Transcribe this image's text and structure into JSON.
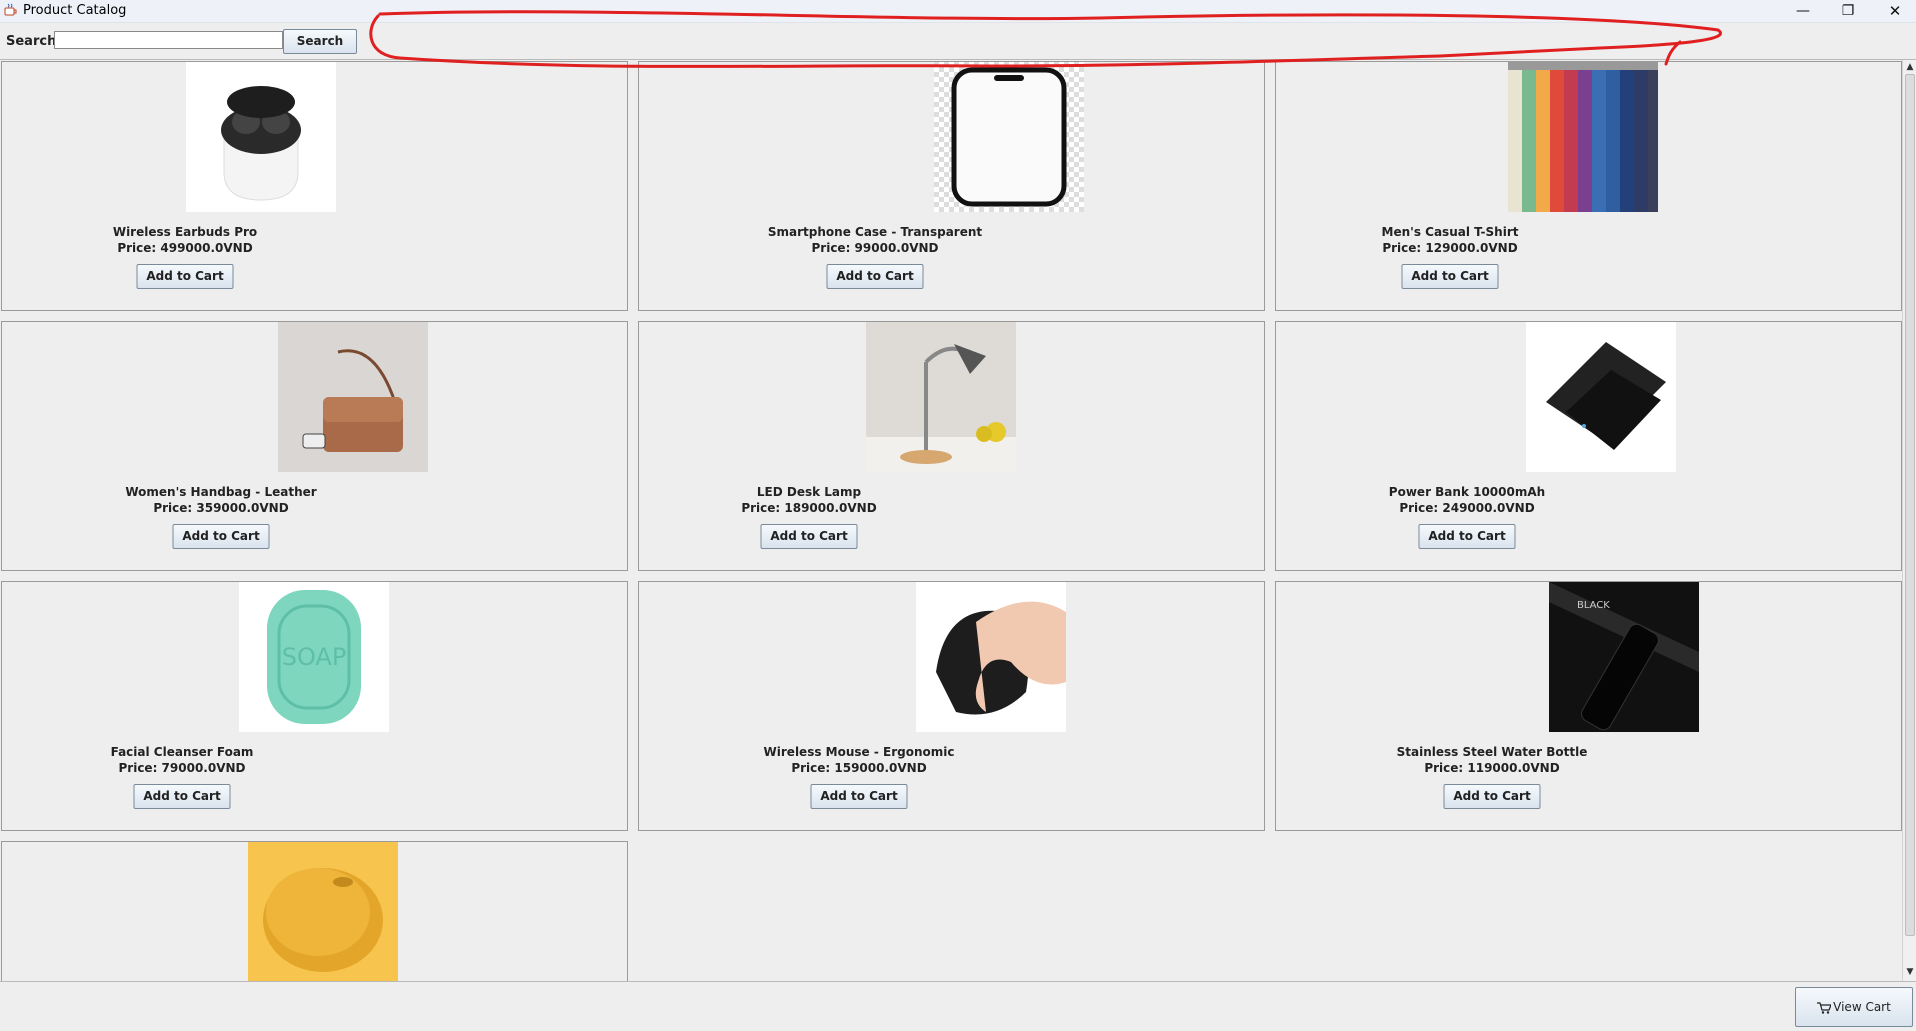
{
  "window": {
    "title": "Product Catalog",
    "minimize": "—",
    "maximize": "❐",
    "close": "✕"
  },
  "search": {
    "label": "Search:",
    "value": "",
    "placeholder": "",
    "button_label": "Search"
  },
  "products": [
    {
      "name": "Wireless Earbuds Pro",
      "price": "Price: 499000.0VND",
      "button": "Add to Cart",
      "image": "earbuds-image"
    },
    {
      "name": "Smartphone Case - Transparent",
      "price": "Price: 99000.0VND",
      "button": "Add to Cart",
      "image": "phone-case-image"
    },
    {
      "name": "Men's Casual T-Shirt",
      "price": "Price: 129000.0VND",
      "button": "Add to Cart",
      "image": "tshirts-image"
    },
    {
      "name": "Women's Handbag - Leather",
      "price": "Price: 359000.0VND",
      "button": "Add to Cart",
      "image": "handbag-image"
    },
    {
      "name": "LED Desk Lamp",
      "price": "Price: 189000.0VND",
      "button": "Add to Cart",
      "image": "desk-lamp-image"
    },
    {
      "name": "Power Bank 10000mAh",
      "price": "Price: 249000.0VND",
      "button": "Add to Cart",
      "image": "power-bank-image"
    },
    {
      "name": "Facial Cleanser Foam",
      "price": "Price: 79000.0VND",
      "button": "Add to Cart",
      "image": "soap-image"
    },
    {
      "name": "Wireless Mouse - Ergonomic",
      "price": "Price: 159000.0VND",
      "button": "Add to Cart",
      "image": "mouse-image"
    },
    {
      "name": "Stainless Steel Water Bottle",
      "price": "Price: 119000.0VND",
      "button": "Add to Cart",
      "image": "water-bottle-image"
    },
    {
      "image": "speaker-image"
    }
  ],
  "image_text": {
    "soap": "SOAP",
    "bottle": "BLACK"
  },
  "footer": {
    "view_cart_label": "View Cart"
  },
  "colors": {
    "annotation": "#e02020",
    "button_border": "#7a8a99",
    "panel_bg": "#eeeeee"
  }
}
